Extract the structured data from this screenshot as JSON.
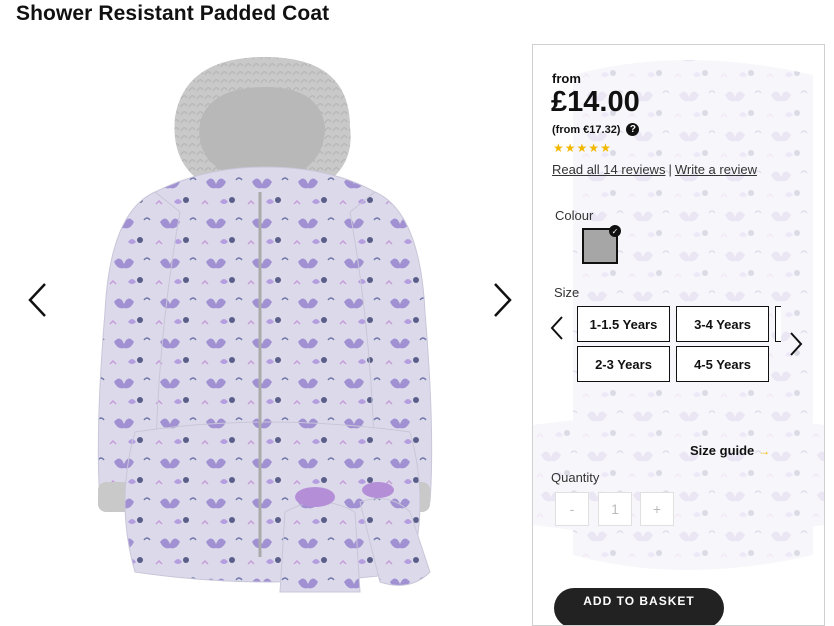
{
  "product": {
    "title": "Shower Resistant Padded Coat"
  },
  "gallery": {
    "prev_icon": "chevron-left-icon",
    "next_icon": "chevron-right-icon",
    "image_alt": "Lilac butterfly print padded coat with faux fur hood and mittens"
  },
  "pricing": {
    "from_label": "from",
    "price": "£14.00",
    "alt_price": "(from €17.32)",
    "help_icon": "?"
  },
  "rating": {
    "stars": 5,
    "star_glyph": "★",
    "read_reviews": "Read all 14 reviews",
    "separator": "|",
    "write_review": "Write a review"
  },
  "colour": {
    "label": "Colour",
    "selected_hex": "#a6a6a6",
    "check": "✓"
  },
  "size": {
    "label": "Size",
    "options": [
      "1-1.5 Years",
      "3-4 Years",
      "2-3 Years",
      "4-5 Years"
    ]
  },
  "size_guide": {
    "label": "Size guide",
    "arrow": "→"
  },
  "quantity": {
    "label": "Quantity",
    "minus": "-",
    "value": "1",
    "plus": "+"
  },
  "basket": {
    "label": "ADD TO BASKET"
  },
  "colors": {
    "accent_star": "#f2b800",
    "coat": "#d8d6e6",
    "fur": "#c8c8c8"
  }
}
